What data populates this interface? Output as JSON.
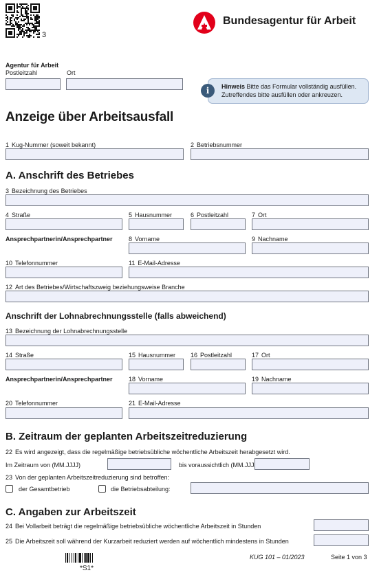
{
  "header": {
    "qr_number": "3",
    "brand_name": "Bundesagentur für Arbeit",
    "brand_color": "#e2001a"
  },
  "agency": {
    "title": "Agentur für Arbeit",
    "postcode_label": "Postleitzahl",
    "city_label": "Ort"
  },
  "info_box": {
    "bold": "Hinweis",
    "text": " Bitte das Formular vollständig ausfüllen. Zutreffendes bitte ausfüllen oder ankreuzen."
  },
  "form_title": "Anzeige über Arbeitsausfall",
  "top_fields": {
    "f1_num": "1",
    "f1_label": "Kug-Nummer (soweit bekannt)",
    "f2_num": "2",
    "f2_label": "Betriebsnummer"
  },
  "section_a": {
    "heading": "A. Anschrift des Betriebes",
    "f3": {
      "num": "3",
      "label": "Bezeichnung des Betriebes"
    },
    "f4": {
      "num": "4",
      "label": "Straße"
    },
    "f5": {
      "num": "5",
      "label": "Hausnummer"
    },
    "f6": {
      "num": "6",
      "label": "Postleitzahl"
    },
    "f7": {
      "num": "7",
      "label": "Ort"
    },
    "contact_label": "Ansprechpartnerin/Ansprechpartner",
    "f8": {
      "num": "8",
      "label": "Vorname"
    },
    "f9": {
      "num": "9",
      "label": "Nachname"
    },
    "f10": {
      "num": "10",
      "label": "Telefonnummer"
    },
    "f11": {
      "num": "11",
      "label": "E-Mail-Adresse"
    },
    "f12": {
      "num": "12",
      "label": "Art des Betriebes/Wirtschaftszweig beziehungsweise Branche"
    }
  },
  "payroll": {
    "heading": "Anschrift der Lohnabrechnungsstelle (falls abweichend)",
    "f13": {
      "num": "13",
      "label": "Bezeichnung der Lohnabrechnungsstelle"
    },
    "f14": {
      "num": "14",
      "label": "Straße"
    },
    "f15": {
      "num": "15",
      "label": "Hausnummer"
    },
    "f16": {
      "num": "16",
      "label": "Postleitzahl"
    },
    "f17": {
      "num": "17",
      "label": "Ort"
    },
    "contact_label": "Ansprechpartnerin/Ansprechpartner",
    "f18": {
      "num": "18",
      "label": "Vorname"
    },
    "f19": {
      "num": "19",
      "label": "Nachname"
    },
    "f20": {
      "num": "20",
      "label": "Telefonnummer"
    },
    "f21": {
      "num": "21",
      "label": "E-Mail-Adresse"
    }
  },
  "section_b": {
    "heading": "B. Zeitraum der geplanten Arbeitszeitreduzierung",
    "f22": {
      "num": "22",
      "label": "Es wird angezeigt, dass die regelmäßige betriebsübliche wöchentliche Arbeitszeit herabgesetzt wird."
    },
    "period_from": "Im Zeitraum von (MM.JJJJ)",
    "period_to": "bis voraussichtlich (MM.JJJJ)",
    "f23": {
      "num": "23",
      "label": "Von der geplanten Arbeitszeitreduzierung sind betroffen:"
    },
    "opt_total": "der Gesamtbetrieb",
    "opt_dept": "die Betriebsabteilung:"
  },
  "section_c": {
    "heading": "C. Angaben zur Arbeitszeit",
    "f24": {
      "num": "24",
      "label": "Bei Vollarbeit beträgt die regelmäßige betriebsübliche wöchentliche Arbeitszeit in Stunden"
    },
    "f25": {
      "num": "25",
      "label": "Die Arbeitszeit soll während der Kurzarbeit reduziert werden auf wöchentlich mindestens in Stunden"
    }
  },
  "footer": {
    "barcode_text": "*S1*",
    "form_code": "KUG 101 – 01/2023",
    "page": "Seite 1 von 3"
  }
}
